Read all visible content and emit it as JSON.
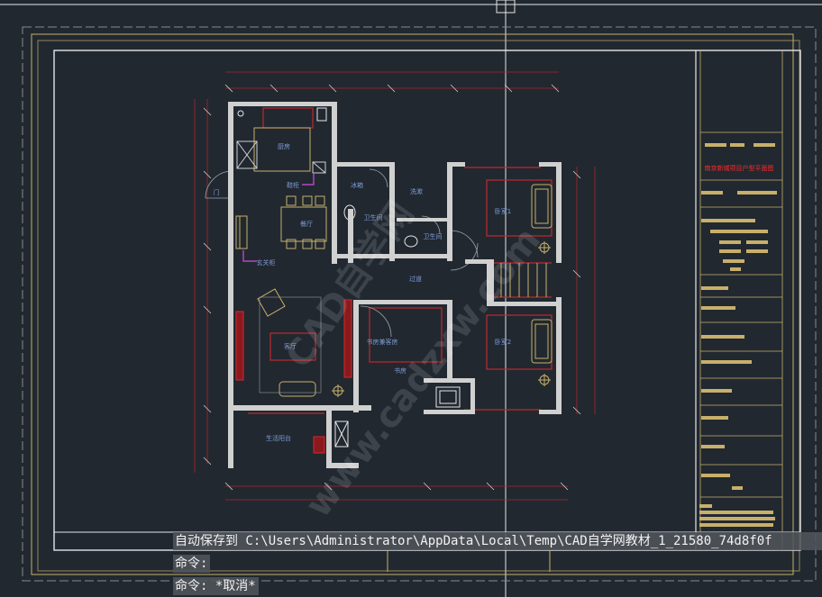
{
  "app": "CAD",
  "drawing": {
    "room_labels": {
      "kitchen": "厨房",
      "dining": "餐厅",
      "hall": "过道",
      "living": "客厅",
      "bath1": "卫生间",
      "bath2": "卫生间",
      "bed1": "卧室1",
      "bed2": "卧室2",
      "study": "书房",
      "balcony": "生活阳台",
      "study_bed": "书房兼客房",
      "wash": "洗漱"
    },
    "annotations": {
      "shoe_cabinet": "鞋柜",
      "entry_cabinet": "玄关柜",
      "fridge": "冰箱",
      "door_mark": "门"
    },
    "title_block": {
      "project_title": "南京新城项目户型平面图"
    }
  },
  "watermark": {
    "line1": "CAD自学网",
    "line2": "www.cadzxw.com"
  },
  "command_window": {
    "autosave": "自动保存到 C:\\Users\\Administrator\\AppData\\Local\\Temp\\CAD自学网教材_1_21580_74d8f0f",
    "line1": "命令:",
    "line2": "命令: *取消*"
  },
  "colors": {
    "background": "#212830",
    "frame": "#ffffff",
    "outer_frame": "#c8b06a",
    "wall": "#d0d0d0",
    "furniture": "#c8b06a",
    "red_lines": "#c0282d",
    "dimension": "#b0252a",
    "text": "#7f9bd6",
    "title": "#ff2a2a"
  }
}
